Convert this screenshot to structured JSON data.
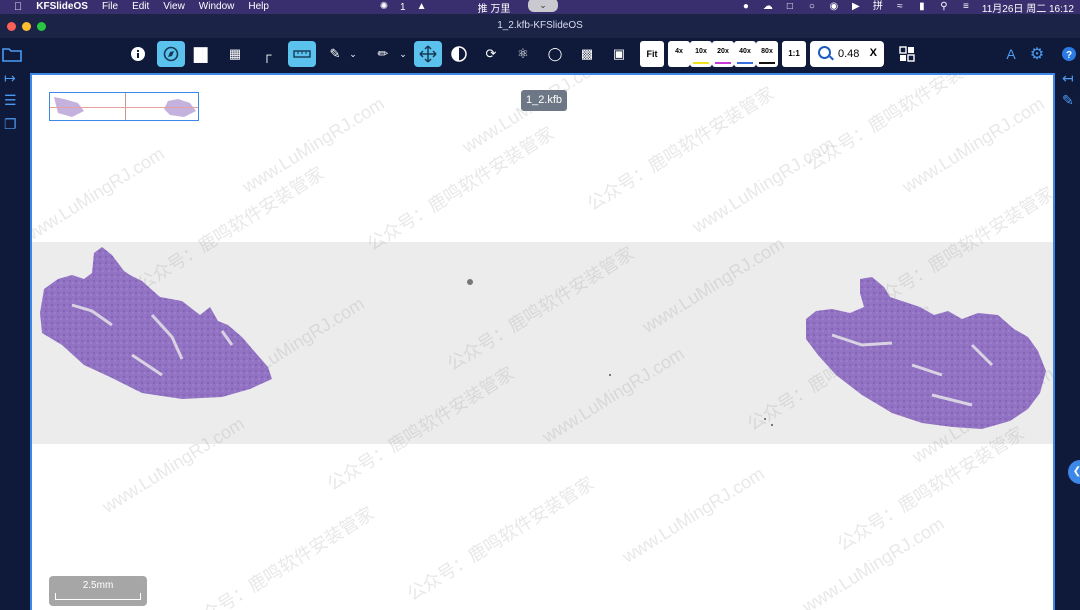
{
  "menubar": {
    "app_name": "KFSlideOS",
    "menus": [
      "File",
      "Edit",
      "View",
      "Window",
      "Help"
    ],
    "center_count": "1",
    "center_text": "推 万里",
    "datetime": "11月26日 周二  16:12",
    "input_method": "拼"
  },
  "window": {
    "title": "1_2.kfb-KFSlideOS",
    "traffic_colors": [
      "#fe5f57",
      "#febc2e",
      "#28c840"
    ]
  },
  "toolbar": {
    "fit_label": "Fit",
    "magnifications": [
      {
        "label": "4x",
        "color": "#ffffff"
      },
      {
        "label": "10x",
        "color": "#f2e21b"
      },
      {
        "label": "20x",
        "color": "#c83ad6"
      },
      {
        "label": "40x",
        "color": "#3a6fe0"
      },
      {
        "label": "80x",
        "color": "#111111"
      }
    ],
    "one_to_one": "1:1",
    "zoom_value": "0.48",
    "zoom_clear": "X",
    "accent": "#5bc2ee"
  },
  "viewer": {
    "file_badge": "1_2.kfb",
    "scale_label": "2.5mm",
    "watermark_text": [
      "www.LuMingRJ.com",
      "公众号：鹿鸣软件安装管家"
    ]
  },
  "icons": {
    "info": "info-icon",
    "navigator": "compass-icon",
    "barcode": "barcode-icon",
    "grid": "grid-icon",
    "corner": "corner-icon",
    "measure": "ruler-icon",
    "annotate": "annotate-icon",
    "pen": "pen-icon",
    "move": "move-icon",
    "contrast": "contrast-icon",
    "rotate": "rotate-icon",
    "microscope": "microscope-icon",
    "circle": "circle-icon",
    "crop": "crop-icon",
    "camera": "camera-icon",
    "layout": "layout-icon",
    "font": "font-icon",
    "settings": "gear-icon",
    "help": "help-icon"
  }
}
